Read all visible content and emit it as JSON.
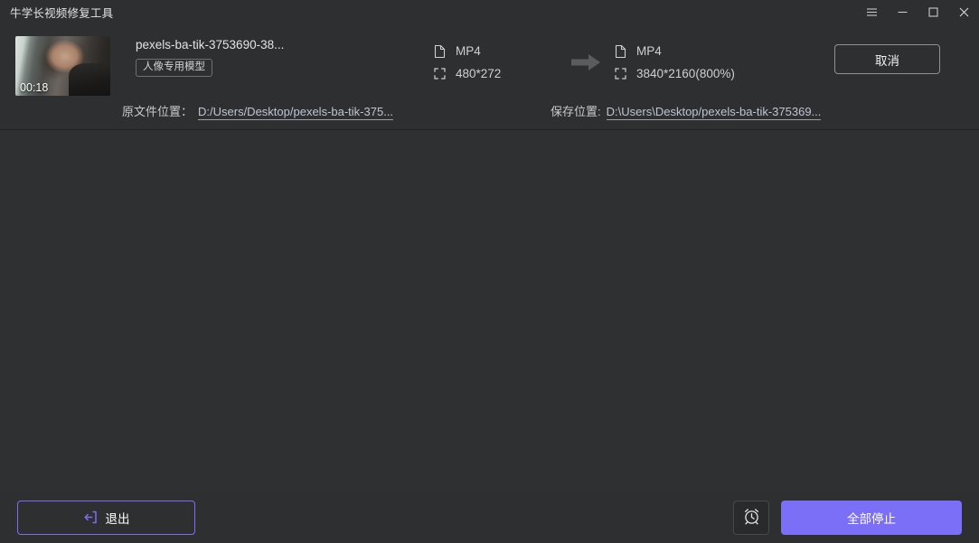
{
  "window": {
    "title": "牛学长视频修复工具",
    "controls": [
      {
        "name": "menu-button",
        "icon": "hamburger-icon"
      },
      {
        "name": "minimize-button",
        "icon": "minimize-icon"
      },
      {
        "name": "maximize-button",
        "icon": "maximize-icon"
      },
      {
        "name": "close-button",
        "icon": "close-icon"
      }
    ]
  },
  "task": {
    "thumbnail": {
      "duration": "00:18",
      "alt": "video-thumbnail"
    },
    "filename": "pexels-ba-tik-3753690-38...",
    "model_badge": "人像专用模型",
    "source": {
      "format": "MP4",
      "resolution": "480*272",
      "format_icon": "file-icon",
      "resolution_icon": "resize-icon",
      "path_label": "原文件位置：",
      "path_value": "D:/Users/Desktop/pexels-ba-tik-375..."
    },
    "arrow_icon": "arrow-right-icon",
    "output": {
      "format": "MP4",
      "resolution": "3840*2160(800%)",
      "format_icon": "file-icon",
      "resolution_icon": "resize-icon",
      "path_label": "保存位置:",
      "path_value": "D:\\Users\\Desktop/pexels-ba-tik-375369..."
    },
    "cancel_label": "取消"
  },
  "footer": {
    "exit_label": "退出",
    "exit_icon": "exit-icon",
    "timer_icon": "alarm-clock-icon",
    "stop_all_label": "全部停止"
  },
  "colors": {
    "background": "#2d2f31",
    "main_background": "#2e3032",
    "accent_purple": "#7c6ff7",
    "accent_purple_border": "#7a6ff4",
    "text_primary": "#e2e3e4",
    "text_secondary": "#c8c9ca",
    "link": "#bfc6d2",
    "divider": "#1f2123"
  }
}
